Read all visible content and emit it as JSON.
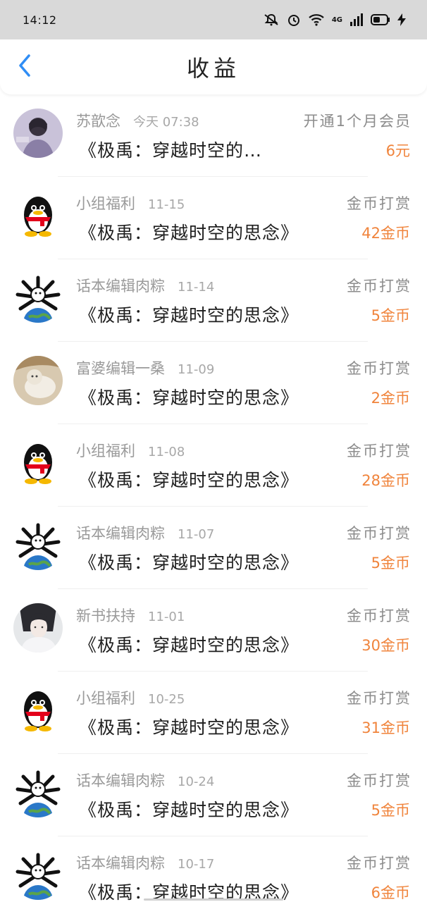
{
  "status_bar": {
    "time": "14:12",
    "network": "4G",
    "icons": [
      "mute-icon",
      "alarm-icon",
      "wifi-icon",
      "signal-icon",
      "battery-icon",
      "charging-icon"
    ]
  },
  "header": {
    "title": "收益",
    "back_icon": "chevron-left-icon",
    "accent_color": "#2f8df5"
  },
  "colors": {
    "amount": "#f0843c",
    "meta": "#9a9a9a"
  },
  "items": [
    {
      "name": "苏歆念",
      "date": "今天 07:38",
      "title": "《极禹：穿越时空的…",
      "type": "开通1个月会员",
      "amount": "6元",
      "avatar": "girl-photo"
    },
    {
      "name": "小组福利",
      "date": "11-15",
      "title": "《极禹：穿越时空的思念》",
      "type": "金币打赏",
      "amount": "42金币",
      "avatar": "penguin-icon"
    },
    {
      "name": "话本编辑肉粽",
      "date": "11-14",
      "title": "《极禹：穿越时空的思念》",
      "type": "金币打赏",
      "amount": "5金币",
      "avatar": "globe-icon"
    },
    {
      "name": "富婆编辑一桑",
      "date": "11-09",
      "title": "《极禹：穿越时空的思念》",
      "type": "金币打赏",
      "amount": "2金币",
      "avatar": "cat-photo"
    },
    {
      "name": "小组福利",
      "date": "11-08",
      "title": "《极禹：穿越时空的思念》",
      "type": "金币打赏",
      "amount": "28金币",
      "avatar": "penguin-icon"
    },
    {
      "name": "话本编辑肉粽",
      "date": "11-07",
      "title": "《极禹：穿越时空的思念》",
      "type": "金币打赏",
      "amount": "5金币",
      "avatar": "globe-icon"
    },
    {
      "name": "新书扶持",
      "date": "11-01",
      "title": "《极禹：穿越时空的思念》",
      "type": "金币打赏",
      "amount": "30金币",
      "avatar": "anime-photo"
    },
    {
      "name": "小组福利",
      "date": "10-25",
      "title": "《极禹：穿越时空的思念》",
      "type": "金币打赏",
      "amount": "31金币",
      "avatar": "penguin-icon"
    },
    {
      "name": "话本编辑肉粽",
      "date": "10-24",
      "title": "《极禹：穿越时空的思念》",
      "type": "金币打赏",
      "amount": "5金币",
      "avatar": "globe-icon"
    },
    {
      "name": "话本编辑肉粽",
      "date": "10-17",
      "title": "《极禹：穿越时空的思念》",
      "type": "金币打赏",
      "amount": "6金币",
      "avatar": "globe-icon"
    }
  ]
}
